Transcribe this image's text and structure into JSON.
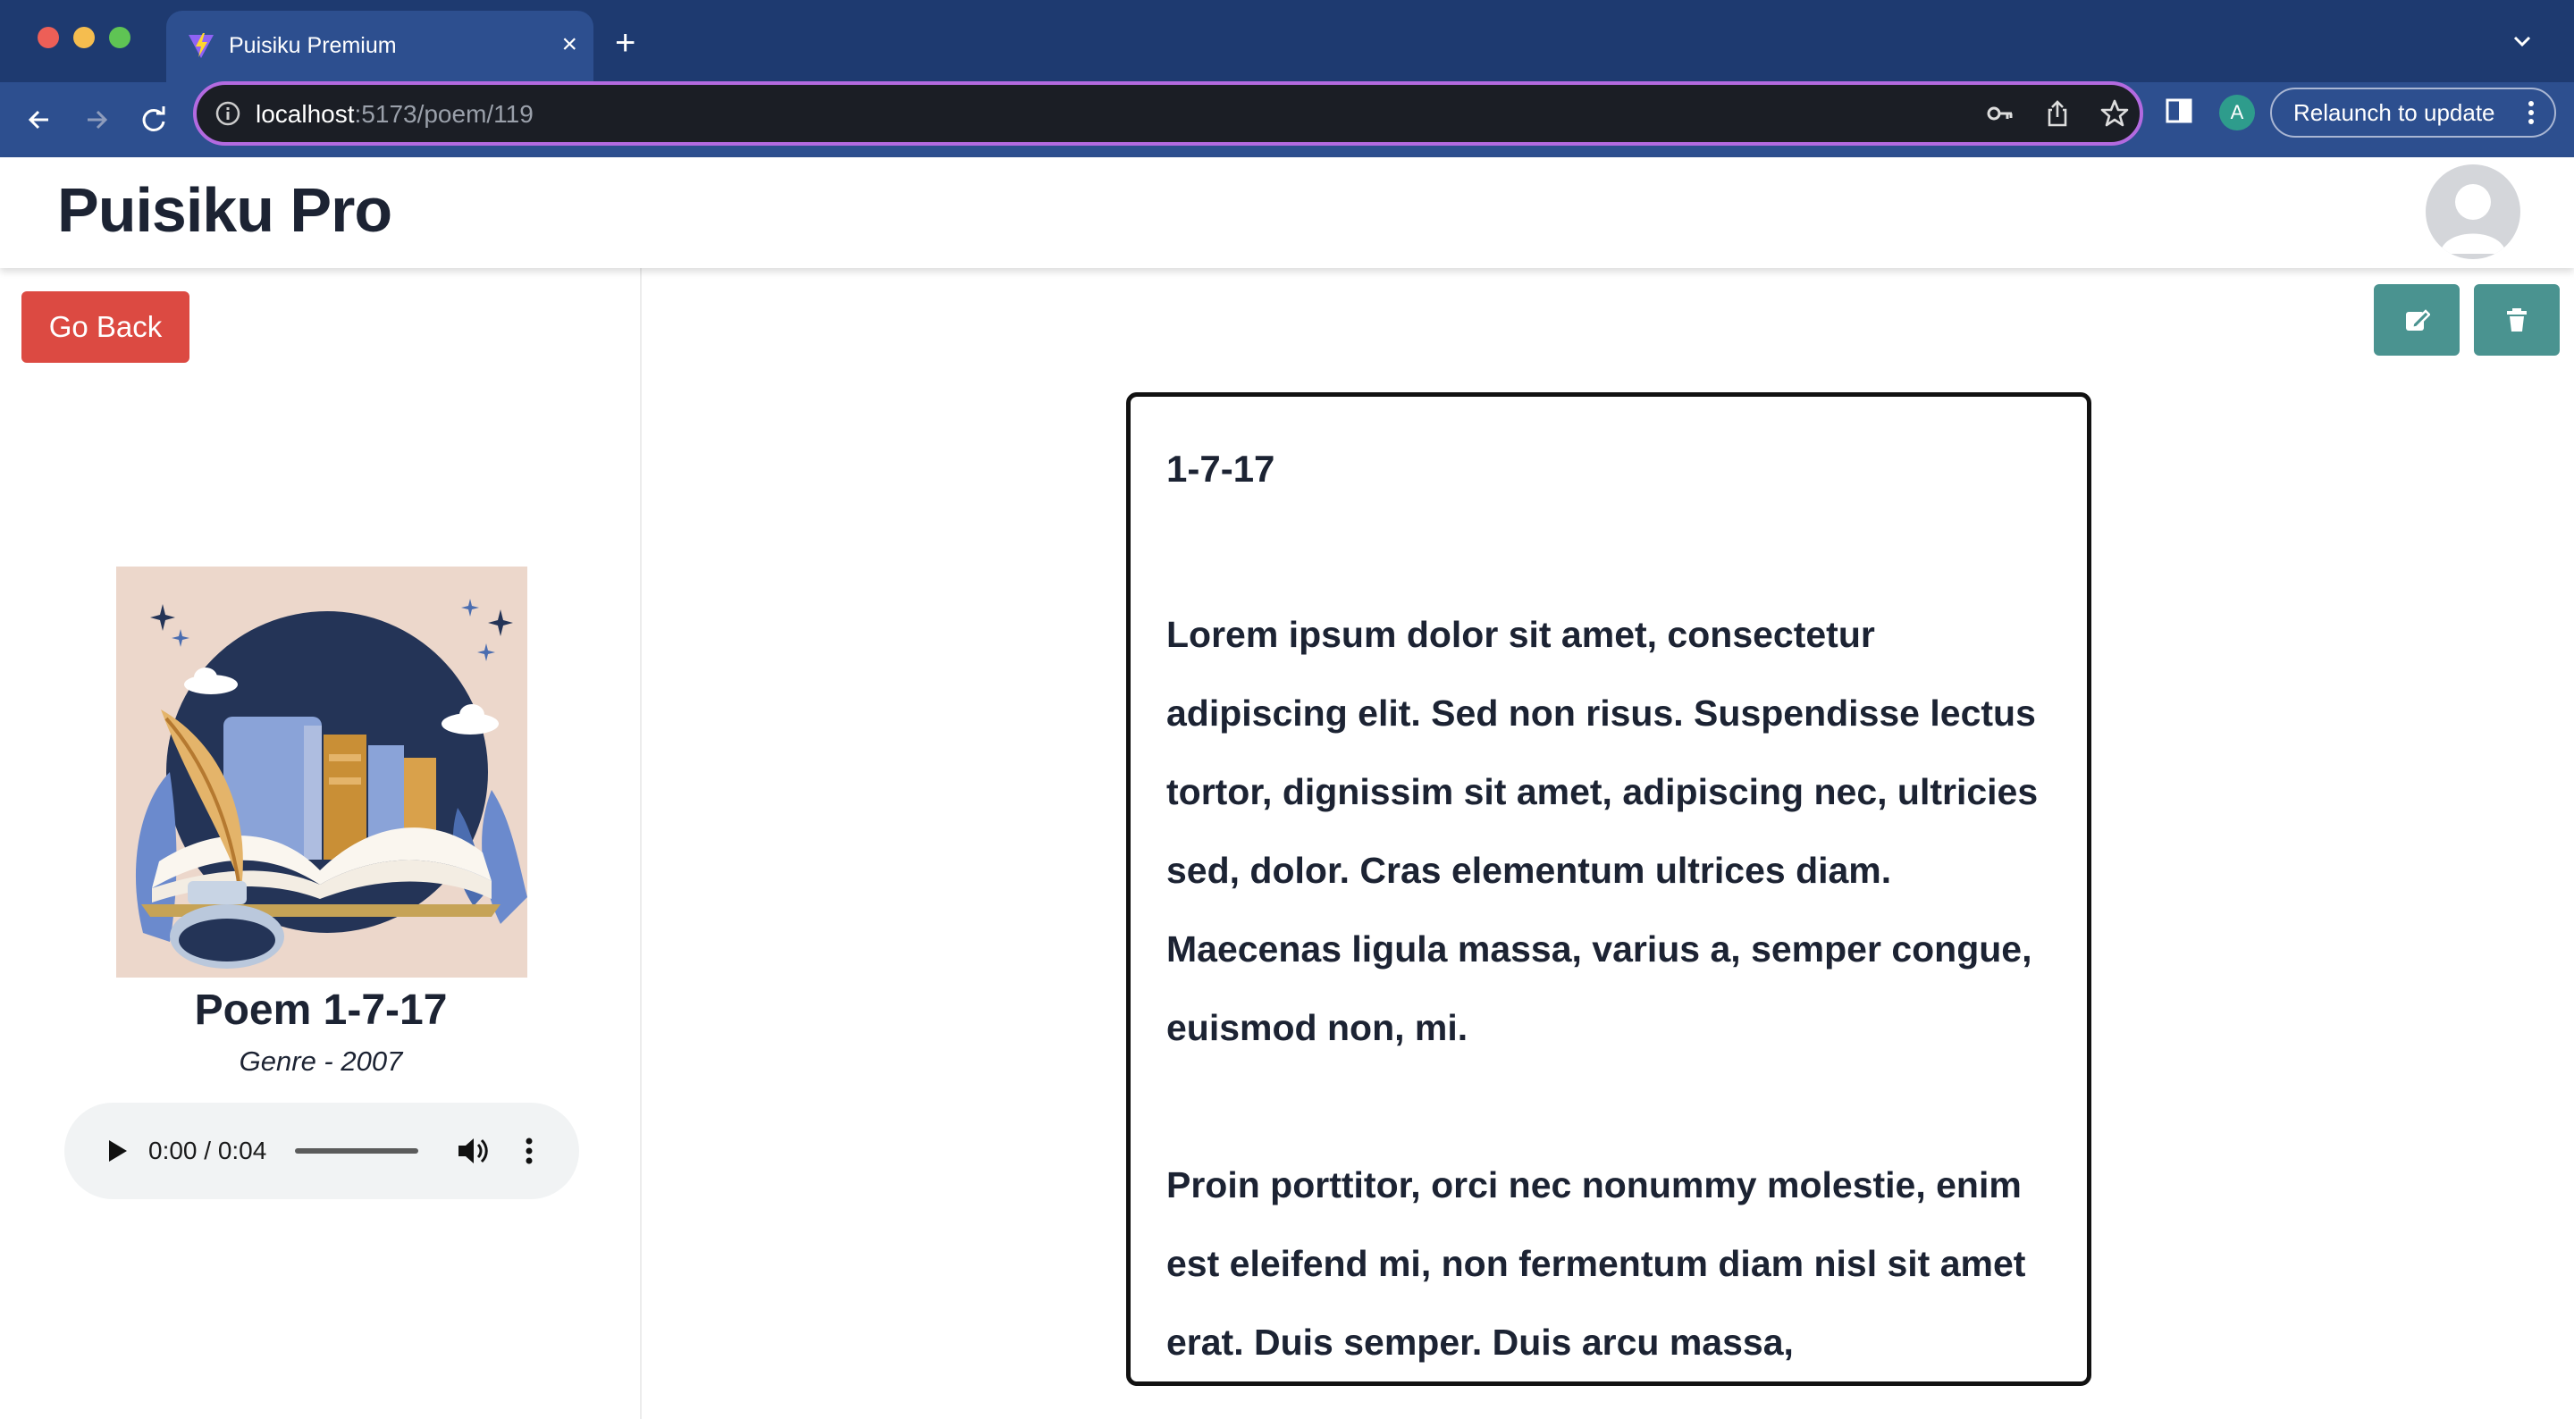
{
  "browser": {
    "tab_title": "Puisiku Premium",
    "url_host": "localhost",
    "url_path": ":5173/poem/119",
    "profile_initial": "A",
    "relaunch_label": "Relaunch to update"
  },
  "app": {
    "title": "Puisiku Pro"
  },
  "sidebar": {
    "go_back_label": "Go Back",
    "poem_heading": "Poem 1-7-17",
    "poem_subtitle": "Genre - 2007",
    "audio": {
      "time_display": "0:00 / 0:04"
    }
  },
  "poem": {
    "title": "1-7-17",
    "paragraphs": [
      "Lorem ipsum dolor sit amet, consectetur adipiscing elit. Sed non risus. Suspendisse lectus tortor, dignissim sit amet, adipiscing nec, ultricies sed, dolor. Cras elementum ultrices diam. Maecenas ligula massa, varius a, semper congue, euismod non, mi.",
      "Proin porttitor, orci nec nonummy molestie, enim est eleifend mi, non fermentum diam nisl sit amet erat. Duis semper. Duis arcu massa,"
    ]
  },
  "icons": {
    "edit": "edit-icon",
    "delete": "trash-icon",
    "play": "play-icon",
    "volume": "volume-icon"
  },
  "colors": {
    "go_back": "#dc4a42",
    "action_buttons": "#4a9390",
    "browser_chrome": "#2d4f8f"
  }
}
